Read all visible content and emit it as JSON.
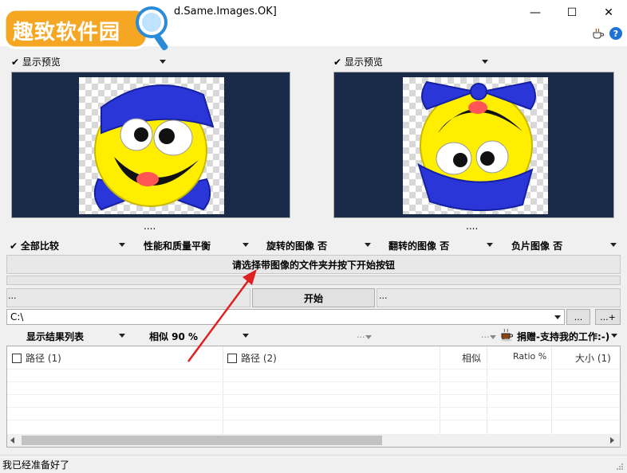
{
  "window": {
    "title": "d.Same.Images.OK]",
    "minimize": "—",
    "maximize": "☐",
    "close": "✕"
  },
  "logo": {
    "text": "趣致软件园"
  },
  "toolbar": {
    "coffee_icon": "coffee-icon",
    "help_label": "?"
  },
  "left_preview": {
    "label": "显示预览",
    "footer": "...."
  },
  "right_preview": {
    "label": "显示预览",
    "footer": "...."
  },
  "options": {
    "compare": "全部比较",
    "balance": "性能和质量平衡",
    "rotated": "旋转的图像 否",
    "flipped": "翻转的图像 否",
    "negative": "负片图像 否"
  },
  "instruction": "请选择带图像的文件夹并按下开始按钮",
  "start_row": {
    "left": "...",
    "start": "开始",
    "right": "..."
  },
  "path": {
    "value": "C:\\",
    "browse": "...",
    "add": "...+"
  },
  "results_bar": {
    "list_mode": "显示结果列表",
    "similarity": "相似 90 %",
    "mid_menu": "...",
    "right_menu": "...",
    "donate": "捐赠-支持我的工作:-)"
  },
  "table": {
    "columns": [
      "路径 (1)",
      "路径 (2)",
      "相似",
      "Ratio %",
      "大小 (1)"
    ]
  },
  "status": {
    "text": "我已经准备好了"
  },
  "colors": {
    "preview_bg": "#1a2b4a",
    "accent_red": "#e02020",
    "hat_blue": "#2b36d8"
  }
}
